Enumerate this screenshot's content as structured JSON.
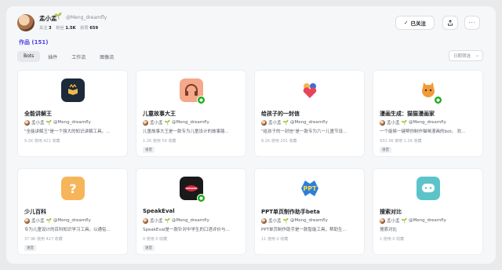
{
  "profile": {
    "name": "孟小孟",
    "sprout_icon": "sprout-icon",
    "handle": "@Meng_dreamfly",
    "stats": [
      {
        "label": "关注",
        "value": "3"
      },
      {
        "label": "粉丝",
        "value": "1.5K"
      },
      {
        "label": "获赞",
        "value": "659"
      }
    ]
  },
  "actions": {
    "follow_label": "已关注",
    "follow_icon": "check-icon",
    "share_icon": "share-icon",
    "more_icon": "more-icon"
  },
  "works": {
    "title": "作品 (151)",
    "tabs": [
      "Bots",
      "插件",
      "工作流",
      "图像流"
    ],
    "active_tab": "Bots",
    "sort_placeholder": "日期筛选"
  },
  "colors": {
    "accent": "#4e40e5",
    "badge": "#1aad19"
  },
  "cards": [
    {
      "title": "全能讲解王",
      "author": "孟小孟",
      "handle": "@Meng_dreamfly",
      "desc": "\"全能讲解王\"是一个强大的知识讲解工具。...",
      "stats": "9.2K 使用  421 收藏",
      "tag": "",
      "icon": "book-crown-icon",
      "badge": false
    },
    {
      "title": "儿童故事大王",
      "author": "孟小孟",
      "handle": "@Meng_dreamfly",
      "desc": "儿童故事大王是一款专为儿童设计的故事路...",
      "stats": "1.2K 使用  59 收藏",
      "tag": "语音",
      "icon": "headphones-icon",
      "badge": true
    },
    {
      "title": "给孩子的一封信",
      "author": "孟小孟",
      "handle": "@Meng_dreamfly",
      "desc": "\"给孩子的一封信\"是一款专为六一儿童节设...",
      "stats": "8.2K 使用  201 收藏",
      "tag": "",
      "icon": "family-heart-icon",
      "badge": false
    },
    {
      "title": "漫画生成：猫猫漫画家",
      "author": "孟小孟",
      "handle": "@Meng_dreamfly",
      "desc": "一个能够一键帮你制作猫咪漫画的bot。 欢...",
      "stats": "932.3K 使用  1.2K 收藏",
      "tag": "语音",
      "icon": "cat-icon",
      "badge": true
    },
    {
      "title": "少儿百科",
      "author": "孟小孟",
      "handle": "@Meng_dreamfly",
      "desc": "专为儿童设计的百科知识学习工具。以通俗...",
      "stats": "37.9K 使用  427 收藏",
      "tag": "语音",
      "icon": "question-icon",
      "badge": false
    },
    {
      "title": "SpeakEval",
      "author": "孟小孟",
      "handle": "@Meng_dreamfly",
      "desc": "SpeakEval是一款针对中学生的口语评价与...",
      "stats": "0 使用  0 收藏",
      "tag": "语音",
      "icon": "lips-icon",
      "badge": true
    },
    {
      "title": "PPT单页制作助手beta",
      "author": "孟小孟",
      "handle": "@Meng_dreamfly",
      "desc": "PPT单页制作助手是一款智能工具，帮助生...",
      "stats": "11 使用  0 收藏",
      "tag": "",
      "icon": "ppt-icon",
      "badge": false
    },
    {
      "title": "搜索对比",
      "author": "孟小孟",
      "handle": "@Meng_dreamfly",
      "desc": "搜索对比",
      "stats": "1 使用  0 收藏",
      "tag": "",
      "icon": "chat-bubble-icon",
      "badge": false
    }
  ]
}
